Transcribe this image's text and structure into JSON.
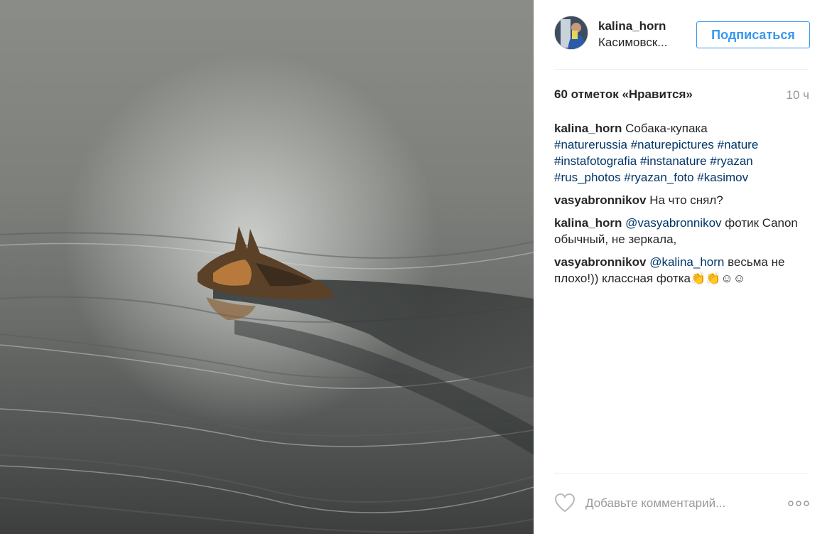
{
  "post": {
    "photo_icon": "swimming-dog-photo"
  },
  "header": {
    "username": "kalina_horn",
    "location": "Касимовск...",
    "follow_label": "Подписаться"
  },
  "stats": {
    "likes": "60 отметок «Нравится»",
    "time": "10 ч"
  },
  "caption": {
    "user": "kalina_horn",
    "text": "Собака-купака",
    "hashtags_line1": "#naturerussia #naturepictures #nature",
    "hashtags_line2": "#instafotografia #instanature #ryazan",
    "hashtags_line3": "#rus_photos #ryazan_foto #kasimov"
  },
  "comments": [
    {
      "user": "vasyabronnikov",
      "mention": "",
      "text": "На что снял?"
    },
    {
      "user": "kalina_horn",
      "mention": "@vasyabronnikov",
      "text": "фотик Canon обычный, не зеркала,"
    },
    {
      "user": "vasyabronnikov",
      "mention": "@kalina_horn",
      "text": "весьма не плохо!)) классная фотка👏👏☺☺"
    }
  ],
  "footer": {
    "comment_placeholder": "Добавьте комментарий...",
    "like_icon": "heart-icon",
    "more_icon": "more-options-icon"
  },
  "colors": {
    "link": "#003569",
    "accent": "#3897f0",
    "muted": "#999999"
  }
}
